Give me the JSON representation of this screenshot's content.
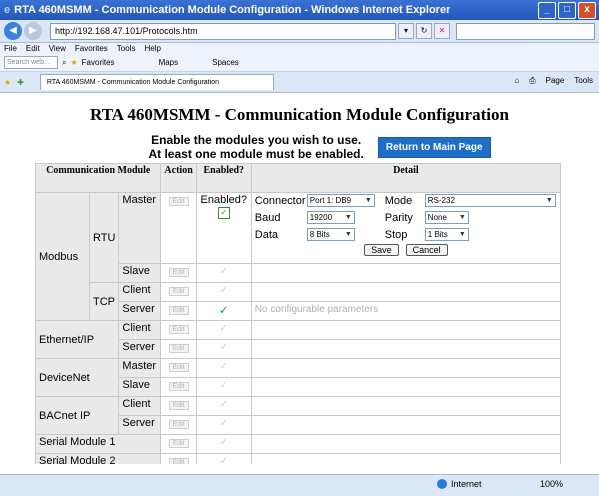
{
  "window": {
    "title": "RTA 460MSMM - Communication Module Configuration - Windows Internet Explorer",
    "buttons": [
      "_",
      "□",
      "x"
    ]
  },
  "addressbar": {
    "url": "http://192.168.47.101/Protocols.htm"
  },
  "menu": {
    "items": [
      "File",
      "Edit",
      "View",
      "Favorites",
      "Tools",
      "Help"
    ],
    "search_placeholder": "Search web...",
    "favorites_label": "Favorites",
    "maps_label": "Maps",
    "spaces_label": "Spaces"
  },
  "tab": {
    "label": "RTA 460MSMM - Communication Module Configuration",
    "page_label": "Page",
    "tools_label": "Tools"
  },
  "page": {
    "title": "RTA 460MSMM - Communication Module Configuration",
    "instruction_line1": "Enable the modules you wish to use.",
    "instruction_line2": "At least one module must be enabled.",
    "main_button": "Return to Main Page"
  },
  "table": {
    "headers": {
      "module": "Communication Module",
      "action": "Action",
      "enabled": "Enabled?",
      "detail": "Detail"
    },
    "edit_label": "Edit",
    "rows": {
      "modbus": "Modbus",
      "rtu": "RTU",
      "master": "Master",
      "slave": "Slave",
      "tcp": "TCP",
      "client": "Client",
      "server": "Server",
      "ethernetip": "Ethernet/IP",
      "devicenet": "DeviceNet",
      "bacnet": "BACnet IP",
      "serial1": "Serial Module 1",
      "serial2": "Serial Module 2"
    },
    "rtu_master_enabled_label": "Enabled?",
    "detail": {
      "connector_label": "Connector",
      "connector_value": "Port 1: DB9",
      "mode_label": "Mode",
      "mode_value": "RS-232",
      "baud_label": "Baud",
      "baud_value": "19200",
      "parity_label": "Parity",
      "parity_value": "None",
      "data_label": "Data",
      "data_value": "8 Bits",
      "stop_label": "Stop",
      "stop_value": "1 Bits",
      "save_label": "Save",
      "cancel_label": "Cancel",
      "no_params": "No configurable parameters"
    }
  },
  "statusbar": {
    "zone": "Internet",
    "zoom": "100%"
  }
}
